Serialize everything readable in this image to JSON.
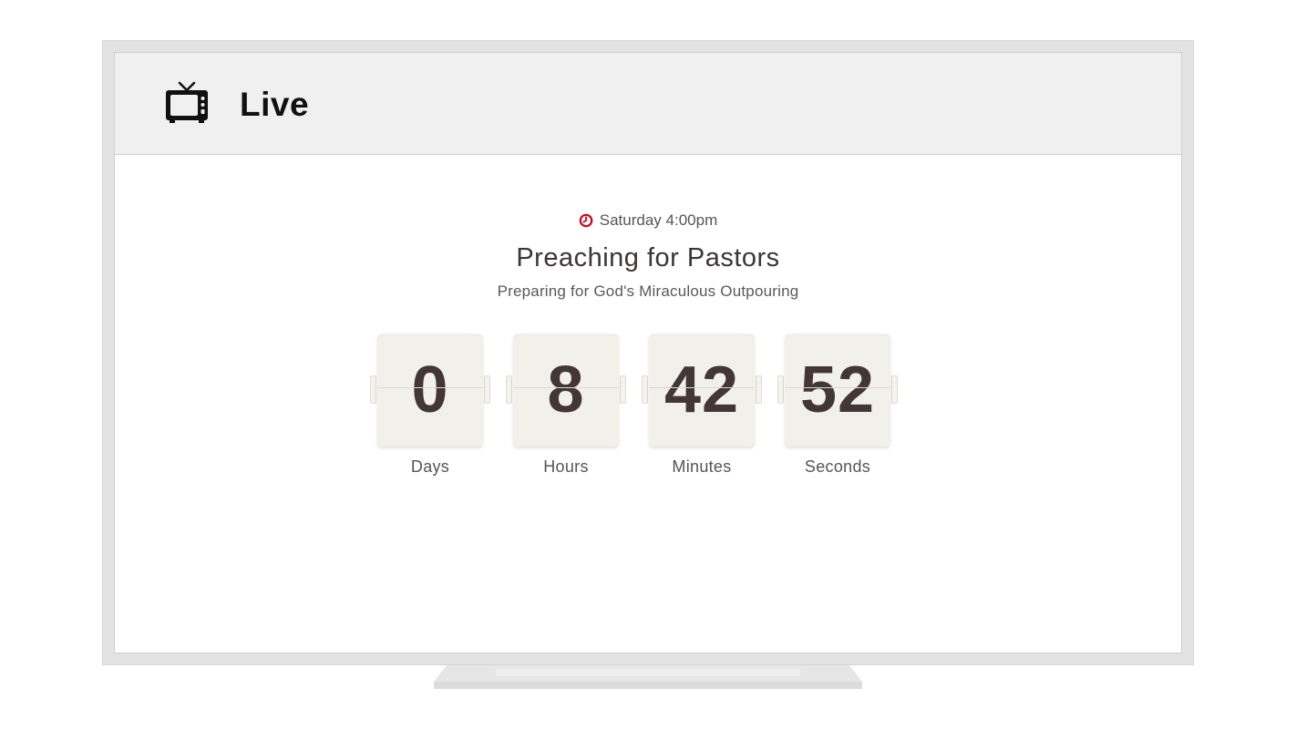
{
  "header": {
    "title": "Live",
    "icon": "tv-icon"
  },
  "event": {
    "schedule": "Saturday 4:00pm",
    "schedule_icon": "clock-icon",
    "title": "Preaching for Pastors",
    "subtitle": "Preparing for God's Miraculous Outpouring"
  },
  "countdown": {
    "days": {
      "value": "0",
      "label": "Days"
    },
    "hours": {
      "value": "8",
      "label": "Hours"
    },
    "minutes": {
      "value": "42",
      "label": "Minutes"
    },
    "seconds": {
      "value": "52",
      "label": "Seconds"
    }
  },
  "colors": {
    "accent": "#d0021b",
    "header_bg": "#f0f0f0",
    "card_bg": "#f1f0ea",
    "digit": "#423636"
  }
}
